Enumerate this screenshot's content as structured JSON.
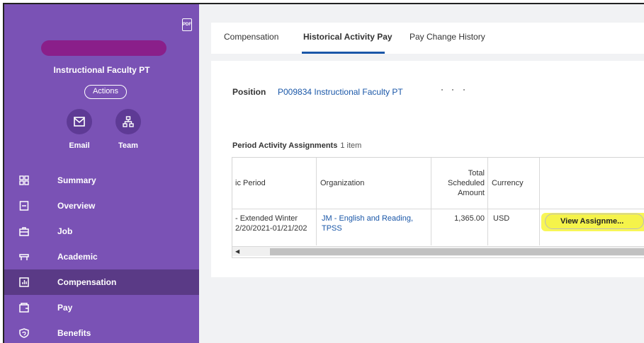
{
  "sidebar": {
    "pdf_icon_text": "PDF",
    "role_title": "Instructional Faculty PT",
    "actions_label": "Actions",
    "quick_actions": [
      {
        "label": "Email",
        "icon": "mail-icon"
      },
      {
        "label": "Team",
        "icon": "org-chart-icon"
      }
    ],
    "nav": [
      {
        "label": "Summary",
        "icon": "grid-icon",
        "active": false
      },
      {
        "label": "Overview",
        "icon": "document-icon",
        "active": false
      },
      {
        "label": "Job",
        "icon": "briefcase-icon",
        "active": false
      },
      {
        "label": "Academic",
        "icon": "mortarboard-icon",
        "active": false
      },
      {
        "label": "Compensation",
        "icon": "bar-chart-icon",
        "active": true
      },
      {
        "label": "Pay",
        "icon": "wallet-icon",
        "active": false
      },
      {
        "label": "Benefits",
        "icon": "shield-icon",
        "active": false
      }
    ]
  },
  "tabs": [
    {
      "label": "Compensation",
      "active": false
    },
    {
      "label": "Historical Activity Pay",
      "active": true
    },
    {
      "label": "Pay Change History",
      "active": false
    }
  ],
  "position": {
    "label": "Position",
    "value": "P009834 Instructional Faculty PT"
  },
  "section": {
    "title": "Period Activity Assignments",
    "count": "1 item"
  },
  "table": {
    "headers": {
      "period": "ic Period",
      "organization": "Organization",
      "amount_line1": "Total",
      "amount_line2": "Scheduled",
      "amount_line3": "Amount",
      "currency": "Currency"
    },
    "row": {
      "period_line1": "- Extended Winter",
      "period_line2": "2/20/2021-01/21/202",
      "organization_line1": "JM - English and Reading,",
      "organization_line2": "TPSS",
      "amount": "1,365.00",
      "currency": "USD",
      "action": "View Assignme..."
    }
  },
  "colors": {
    "sidebar": "#7a52b5",
    "active_nav": "#5a3a86",
    "link": "#1a57a8",
    "highlight": "#f5f34a"
  }
}
